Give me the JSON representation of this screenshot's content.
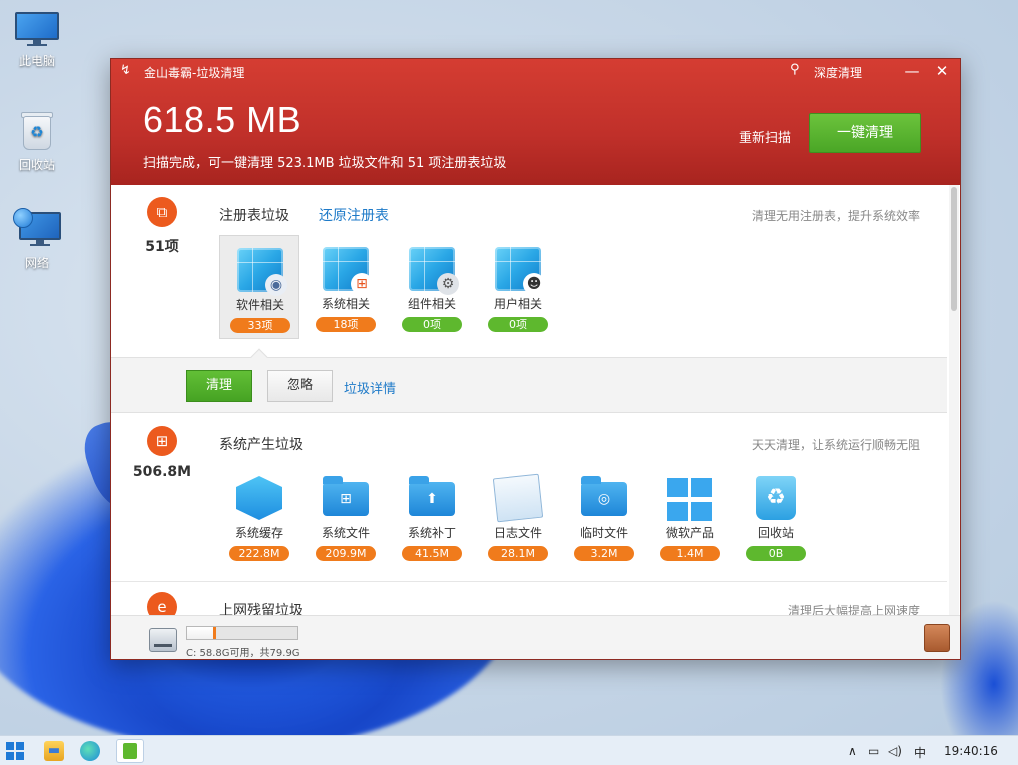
{
  "desktop": {
    "icons": [
      {
        "label": "此电脑",
        "icon": "computer-icon"
      },
      {
        "label": "回收站",
        "icon": "recycle-bin-icon"
      },
      {
        "label": "网络",
        "icon": "network-icon"
      }
    ]
  },
  "window": {
    "title": "金山毒霸-垃圾清理",
    "deep_clean_label": "深度清理",
    "total_size": "618.5 MB",
    "summary": "扫描完成，可一键清理 523.1MB 垃圾文件和 51 项注册表垃圾",
    "rescan_label": "重新扫描",
    "one_click_label": "一键清理",
    "colors": {
      "header": "#c0302a",
      "accent_green": "#5eb82e",
      "accent_orange": "#f07b1c",
      "link": "#1e7ac8"
    }
  },
  "registry": {
    "count": "51项",
    "title": "注册表垃圾",
    "restore_link": "还原注册表",
    "description": "清理无用注册表，提升系统效率",
    "items": [
      {
        "label": "软件相关",
        "badge": "33项",
        "badge_color": "orange",
        "icon": "registry-software-icon"
      },
      {
        "label": "系统相关",
        "badge": "18项",
        "badge_color": "orange",
        "icon": "registry-system-icon"
      },
      {
        "label": "组件相关",
        "badge": "0项",
        "badge_color": "green",
        "icon": "registry-component-icon"
      },
      {
        "label": "用户相关",
        "badge": "0项",
        "badge_color": "green",
        "icon": "registry-user-icon"
      }
    ]
  },
  "actions": {
    "clean_label": "清理",
    "ignore_label": "忽略",
    "details_label": "垃圾详情"
  },
  "system_junk": {
    "count": "506.8M",
    "title": "系统产生垃圾",
    "description": "天天清理，让系统运行顺畅无阻",
    "items": [
      {
        "label": "系统缓存",
        "badge": "222.8M",
        "badge_color": "orange",
        "icon": "system-cache-icon"
      },
      {
        "label": "系统文件",
        "badge": "209.9M",
        "badge_color": "orange",
        "icon": "system-files-folder-icon"
      },
      {
        "label": "系统补丁",
        "badge": "41.5M",
        "badge_color": "orange",
        "icon": "system-patch-folder-icon"
      },
      {
        "label": "日志文件",
        "badge": "28.1M",
        "badge_color": "orange",
        "icon": "log-files-icon"
      },
      {
        "label": "临时文件",
        "badge": "3.2M",
        "badge_color": "orange",
        "icon": "temp-files-folder-icon"
      },
      {
        "label": "微软产品",
        "badge": "1.4M",
        "badge_color": "orange",
        "icon": "microsoft-products-icon"
      },
      {
        "label": "回收站",
        "badge": "0B",
        "badge_color": "green",
        "icon": "recycle-bin-icon"
      }
    ]
  },
  "internet_junk": {
    "title": "上网残留垃圾",
    "description": "清理后大幅提高上网速度"
  },
  "footer": {
    "disk_text": "C: 58.8G可用，共79.9G",
    "disk_used_fraction": 0.264
  },
  "taskbar": {
    "ime": "中",
    "time": "19:40:16"
  }
}
